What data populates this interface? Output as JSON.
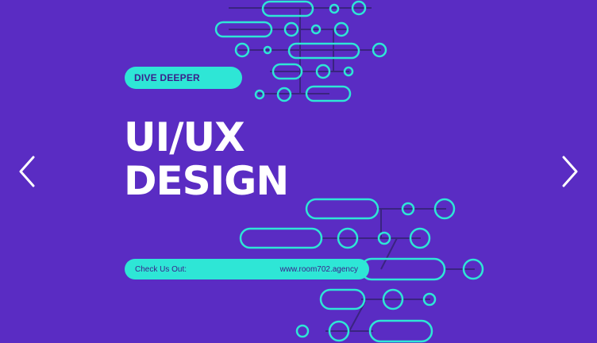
{
  "colors": {
    "background": "#5a2cc3",
    "accent": "#2ee6d6",
    "accent_text": "#3b1f8a",
    "title": "#ffffff",
    "arrow": "#ffffff",
    "connector": "#3a2480"
  },
  "slide": {
    "tagline": "DIVE DEEPER",
    "title_line1": "UI/UX",
    "title_line2": "DESIGN",
    "cta_label": "Check Us Out:",
    "cta_url": "www.room702.agency"
  },
  "carousel": {
    "prev_icon": "chevron-left-icon",
    "next_icon": "chevron-right-icon"
  }
}
